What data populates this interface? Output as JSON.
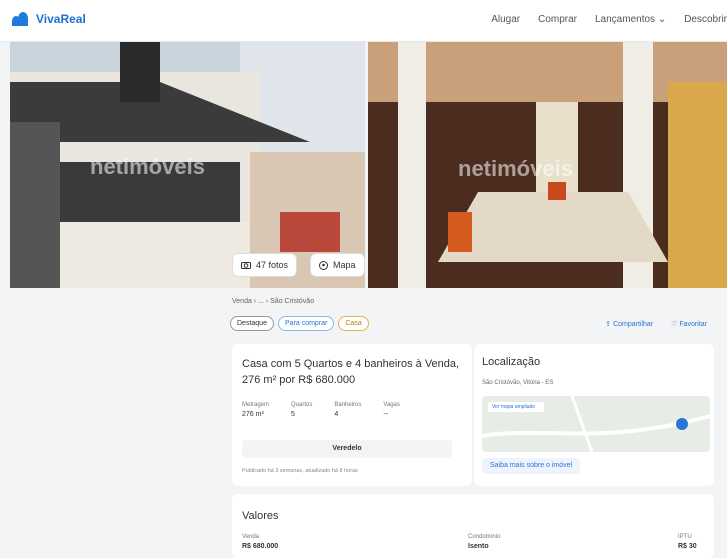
{
  "header": {
    "logo": "VivaReal",
    "nav": [
      "Alugar",
      "Comprar",
      "Lançamentos ⌄",
      "Descobrir"
    ]
  },
  "gallery": {
    "watermark": "netimóveis",
    "photos_button": "47 fotos",
    "map_button": "Mapa"
  },
  "breadcrumb": "Venda  ›  ...  ›  São Cristóvão",
  "tags": [
    "Destaque",
    "Para comprar",
    "Casa"
  ],
  "actions": {
    "share": "Compartilhar",
    "favorite": "Favoritar"
  },
  "listing": {
    "title": "Casa com 5 Quartos e 4 banheiros à Venda, 276 m² por R$ 680.000",
    "features": [
      {
        "label": "Metragem",
        "value": "276 m²"
      },
      {
        "label": "Quartos",
        "value": "5"
      },
      {
        "label": "Banheiros",
        "value": "4"
      },
      {
        "label": "Vagas",
        "value": "--"
      }
    ],
    "visit_button": "Veredelo",
    "note": "Publicado há 3 semanas, atualizado há 8 horas"
  },
  "location": {
    "title": "Localização",
    "address": "São Cristóvão, Vitória - ES",
    "map_label": "Ver mapa ampliado",
    "more_button": "Saiba mais sobre o imóvel"
  },
  "values": {
    "title": "Valores",
    "sale_label": "Venda",
    "sale_value": "R$ 680.000",
    "condo_label": "Condomínio",
    "condo_value": "Isento",
    "iptu_label": "IPTU",
    "iptu_value": "R$ 30"
  },
  "colors": {
    "brand": "#1f6fd1",
    "accent": "#2b74d8"
  }
}
